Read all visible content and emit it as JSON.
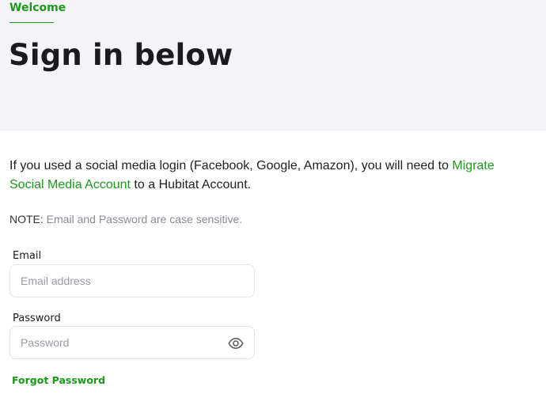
{
  "hero": {
    "eyebrow": "Welcome",
    "title": "Sign in below"
  },
  "intro": {
    "text_before": "If you used a social media login (Facebook, Google, Amazon), you will need to ",
    "link_label": "Migrate Social Media Account",
    "text_after": " to a Hubitat Account."
  },
  "note": {
    "label": "NOTE:",
    "text": " Email and Password are case sensitive."
  },
  "form": {
    "email": {
      "label": "Email",
      "value": "",
      "placeholder": "Email address"
    },
    "password": {
      "label": "Password",
      "value": "",
      "placeholder": "Password",
      "toggle_icon": "eye-icon"
    },
    "forgot_label": "Forgot Password"
  },
  "colors": {
    "accent": "#1a9a18",
    "hero_bg": "#f5f5f9",
    "muted_text": "#8a8a93"
  }
}
